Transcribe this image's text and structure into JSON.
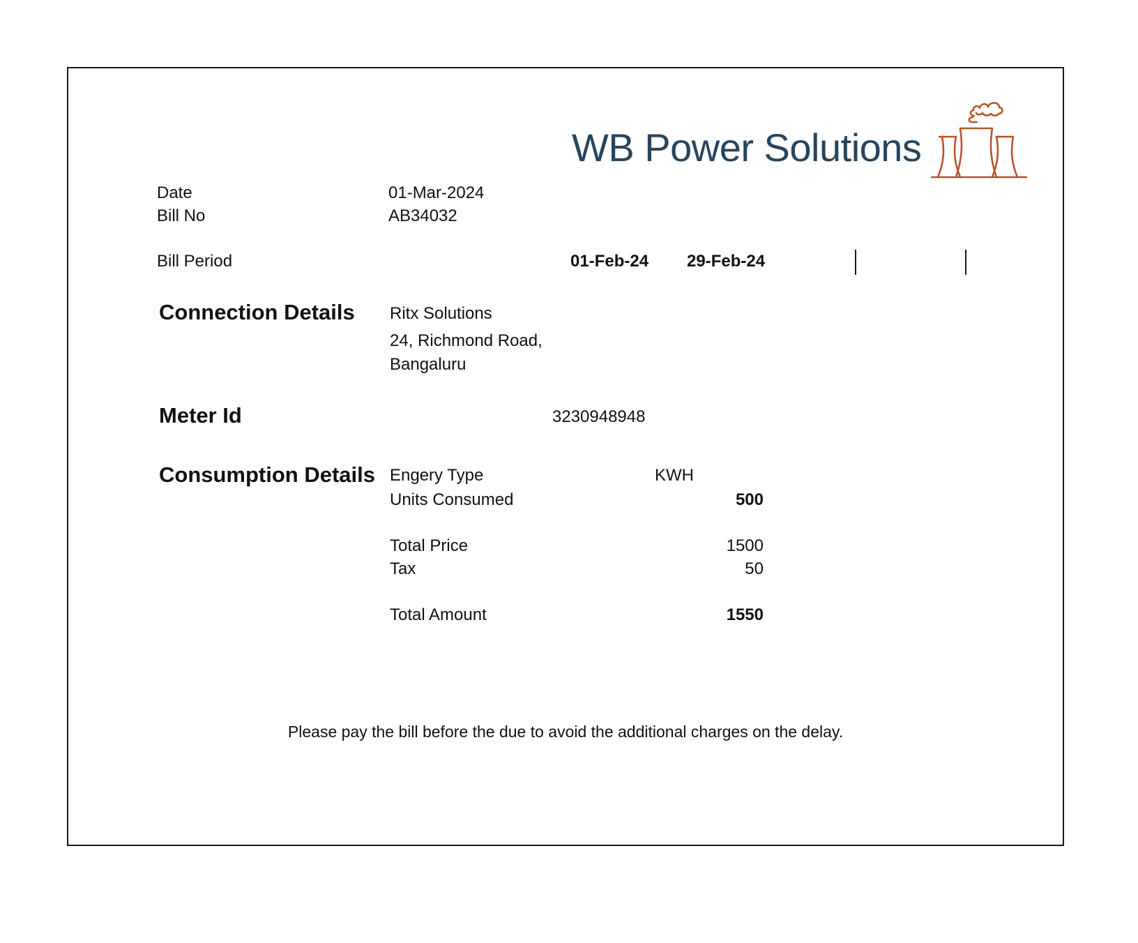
{
  "company": {
    "name": "WB Power Solutions",
    "logo_icon": "power-plant-icon",
    "brand_color": "#27445c",
    "logo_color": "#b5552a"
  },
  "bill": {
    "date_label": "Date",
    "date_value": "01-Mar-2024",
    "bill_no_label": "Bill No",
    "bill_no_value": "AB34032",
    "period_label": "Bill Period",
    "period_start": "01-Feb-24",
    "period_end": "29-Feb-24"
  },
  "connection": {
    "heading": "Connection Details",
    "name": "Ritx Solutions",
    "address_line1": "24, Richmond Road,",
    "address_line2": "Bangaluru"
  },
  "meter": {
    "heading": "Meter Id",
    "value": "3230948948"
  },
  "consumption": {
    "heading": "Consumption Details",
    "energy_type_label": "Engery Type",
    "energy_type_value": "KWH",
    "units_label": "Units Consumed",
    "units_value": "500",
    "total_price_label": "Total Price",
    "total_price_value": "1500",
    "tax_label": "Tax",
    "tax_value": "50",
    "total_amount_label": "Total Amount",
    "total_amount_value": "1550"
  },
  "footer": {
    "note": "Please pay the bill before the due to avoid the additional charges on the delay."
  }
}
